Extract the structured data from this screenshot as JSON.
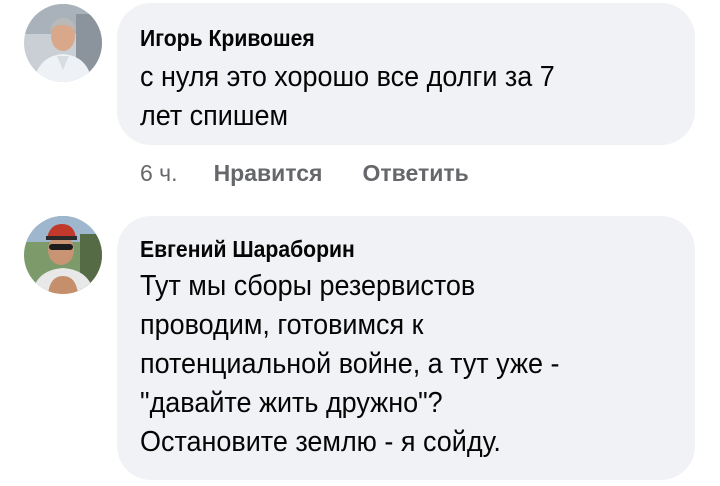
{
  "comments": [
    {
      "author": "Игорь Кривошея",
      "text": "с нуля это хорошо все долги за 7\nлет спишем",
      "time": "6 ч.",
      "like_label": "Нравится",
      "reply_label": "Ответить"
    },
    {
      "author": "Евгений Шараборин",
      "text": "Тут мы сборы резервистов\nпроводим, готовимся к\nпотенциальной войне, а тут уже -\n\"давайте жить дружно\"?\nОстановите землю - я сойду."
    }
  ],
  "colors": {
    "bubble": "#f0f2f5",
    "meta": "#65676b",
    "text": "#050505"
  }
}
